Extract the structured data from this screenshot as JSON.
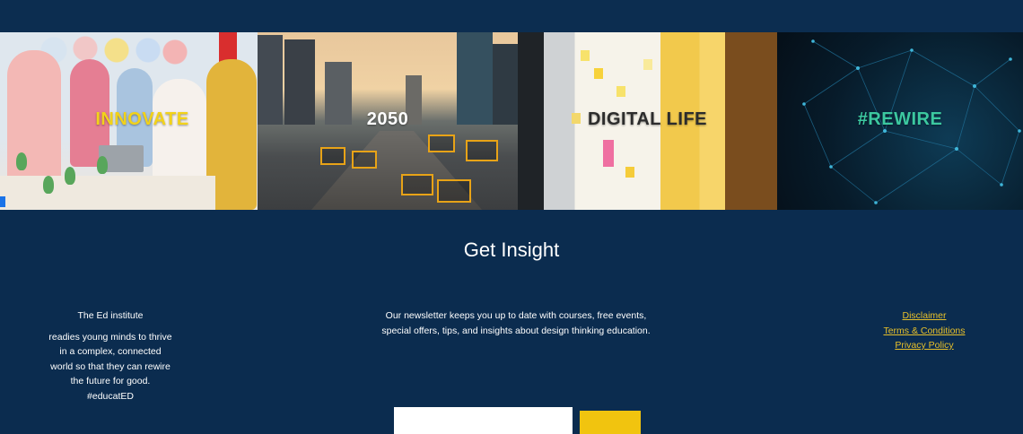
{
  "tiles": [
    {
      "label": "INNOVATE",
      "color": "#f2d21a"
    },
    {
      "label": "2050",
      "color": "#ffffff"
    },
    {
      "label": "DIGITAL LIFE",
      "color": "#2c2c2c"
    },
    {
      "label": "#REWIRE",
      "color": "#3cc8a0"
    }
  ],
  "section": {
    "title": "Get Insight"
  },
  "about": {
    "heading": "The Ed institute",
    "body": "readies young minds to thrive in a complex, connected world so that they can rewire the future for good. #educatED"
  },
  "newsletter": {
    "text": "Our newsletter keeps you up to date with courses, free events, special offers, tips, and insights about design thinking education.",
    "email_placeholder": ""
  },
  "links": [
    "Disclaimer",
    "Terms & Conditions",
    "Privacy Policy"
  ],
  "colors": {
    "background": "#0b2c4f",
    "accent": "#f1c40f",
    "link": "#e8c12a"
  }
}
